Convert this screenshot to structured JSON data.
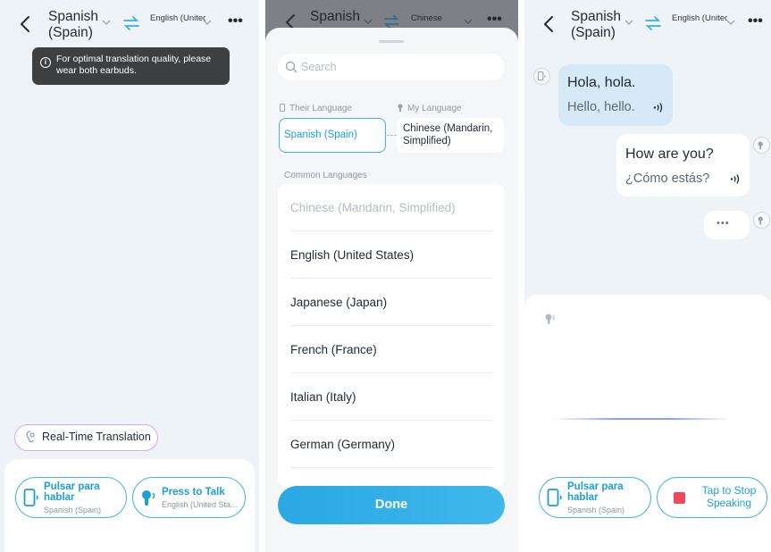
{
  "screen1": {
    "header": {
      "their_language": "Spanish (Spain)",
      "my_language": "English (United Stat...",
      "more": "•••"
    },
    "toast": "For optimal translation quality, please wear both earbuds.",
    "realtime_label": "Real-Time Translation",
    "ptt_left": {
      "title": "Pulsar para hablar",
      "subtitle": "Spanish (Spain)"
    },
    "ptt_right": {
      "title": "Press to Talk",
      "subtitle": "English (United Sta..."
    }
  },
  "screen2": {
    "header": {
      "their_language": "Spanish",
      "my_language": "Chinese",
      "more": "•••"
    },
    "search_placeholder": "Search",
    "their_label": "Their Language",
    "my_label": "My Language",
    "their_value": "Spanish (Spain)",
    "my_value": "Chinese (Mandarin, Simplified)",
    "common_label": "Common Languages",
    "languages": [
      {
        "name": "Chinese (Mandarin, Simplified)",
        "disabled": true
      },
      {
        "name": "English (United States)",
        "disabled": false
      },
      {
        "name": "Japanese (Japan)",
        "disabled": false
      },
      {
        "name": "French (France)",
        "disabled": false
      },
      {
        "name": "Italian (Italy)",
        "disabled": false
      },
      {
        "name": "German (Germany)",
        "disabled": false
      }
    ],
    "done_label": "Done"
  },
  "screen3": {
    "header": {
      "their_language": "Spanish (Spain)",
      "my_language": "English (United Stat...",
      "more": "•••"
    },
    "messages": [
      {
        "original": "Hola, hola.",
        "translation": "Hello, hello."
      },
      {
        "original": "How are you?",
        "translation": "¿Cómo estás?"
      }
    ],
    "typing": "•••",
    "ptt_left": {
      "title": "Pulsar para hablar",
      "subtitle": "Spanish (Spain)"
    },
    "stop_label": "Tap to Stop Speaking"
  },
  "colors": {
    "accent": "#3cb4e4",
    "accent_text": "#1ba0d8",
    "stop_red": "#ee4a5c",
    "panel_bg": "#eef3f8",
    "toast_bg": "#3d3f41"
  }
}
